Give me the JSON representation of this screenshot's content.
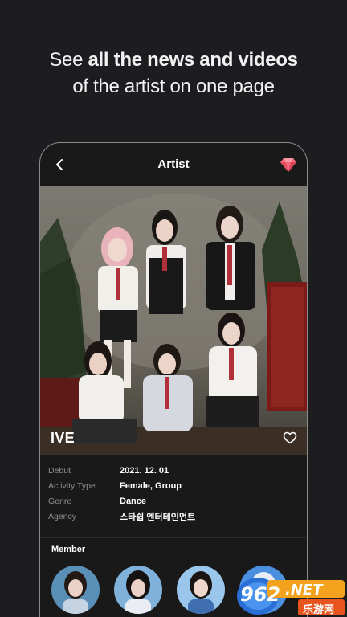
{
  "promo": {
    "line1_light": "See ",
    "line1_bold": "all the news and videos",
    "line2": "of the artist on one page"
  },
  "header": {
    "title": "Artist",
    "back_icon": "chevron-left-icon",
    "premium_icon": "diamond-icon",
    "premium_color": "#f26a7b"
  },
  "artist": {
    "name": "IVE",
    "favorite_icon": "heart-outline-icon"
  },
  "details": [
    {
      "label": "Debut",
      "value": "2021. 12. 01"
    },
    {
      "label": "Activity Type",
      "value": "Female, Group"
    },
    {
      "label": "Genre",
      "value": "Dance"
    },
    {
      "label": "Agency",
      "value": "스타쉽 엔터테인먼트"
    }
  ],
  "members": {
    "title": "Member",
    "count_visible": 4
  },
  "watermark": {
    "number": "962",
    "suffix": ".NET",
    "sub": "乐游网"
  }
}
